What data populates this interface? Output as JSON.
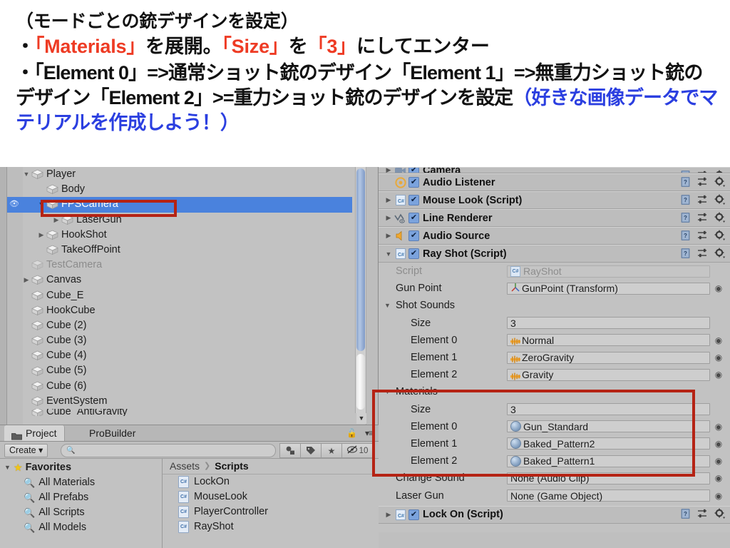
{
  "instructions": {
    "line1": "（モードごとの銃デザインを設定）",
    "line2_bullet": "・",
    "line2_a": "「Materials」",
    "line2_b": "を展開。",
    "line2_c": "「Size」",
    "line2_d": "を",
    "line2_e": "「3」",
    "line2_f": "にしてエンター",
    "line3_bullet": "・",
    "line3_a": "「Element 0」=>通常ショット銃のデザイン「Element 1」=>無重力ショット銃のデザイン「Element 2」>=重力ショット銃のデザインを設定",
    "line3_b": "（好きな画像データでマテリアルを作成しよう！）",
    "colors": {
      "red": "#ee3b24",
      "blue": "#2b3fe0",
      "black": "#111111"
    }
  },
  "hierarchy": {
    "items": [
      {
        "label": "Player",
        "depth": 1,
        "tri": "down",
        "dim": false,
        "selected": false,
        "eye": false
      },
      {
        "label": "Body",
        "depth": 2,
        "tri": "none",
        "dim": false,
        "selected": false,
        "eye": false
      },
      {
        "label": "FPSCamera",
        "depth": 2,
        "tri": "down",
        "dim": false,
        "selected": true,
        "eye": true
      },
      {
        "label": "LaserGun",
        "depth": 3,
        "tri": "right",
        "dim": false,
        "selected": false,
        "eye": false
      },
      {
        "label": "HookShot",
        "depth": 2,
        "tri": "right",
        "dim": false,
        "selected": false,
        "eye": false
      },
      {
        "label": "TakeOffPoint",
        "depth": 2,
        "tri": "none",
        "dim": false,
        "selected": false,
        "eye": false
      },
      {
        "label": "TestCamera",
        "depth": 1,
        "tri": "none",
        "dim": true,
        "selected": false,
        "eye": false
      },
      {
        "label": "Canvas",
        "depth": 1,
        "tri": "right",
        "dim": false,
        "selected": false,
        "eye": false
      },
      {
        "label": "Cube_E",
        "depth": 1,
        "tri": "none",
        "dim": false,
        "selected": false,
        "eye": false
      },
      {
        "label": "HookCube",
        "depth": 1,
        "tri": "none",
        "dim": false,
        "selected": false,
        "eye": false
      },
      {
        "label": "Cube (2)",
        "depth": 1,
        "tri": "none",
        "dim": false,
        "selected": false,
        "eye": false
      },
      {
        "label": "Cube (3)",
        "depth": 1,
        "tri": "none",
        "dim": false,
        "selected": false,
        "eye": false
      },
      {
        "label": "Cube (4)",
        "depth": 1,
        "tri": "none",
        "dim": false,
        "selected": false,
        "eye": false
      },
      {
        "label": "Cube (5)",
        "depth": 1,
        "tri": "none",
        "dim": false,
        "selected": false,
        "eye": false
      },
      {
        "label": "Cube (6)",
        "depth": 1,
        "tri": "none",
        "dim": false,
        "selected": false,
        "eye": false
      },
      {
        "label": "EventSystem",
        "depth": 1,
        "tri": "none",
        "dim": false,
        "selected": false,
        "eye": false
      },
      {
        "label": "Cube_AntiGravity",
        "depth": 1,
        "tri": "none",
        "dim": false,
        "selected": false,
        "eye": false
      }
    ]
  },
  "project": {
    "tabs": [
      {
        "label": "Project",
        "active": true
      },
      {
        "label": "ProBuilder",
        "active": false
      }
    ],
    "create_label": "Create",
    "search_placeholder": "",
    "search_value": "",
    "hidden_count": "10",
    "breadcrumb": {
      "root": "Assets",
      "current": "Scripts"
    },
    "favorites": {
      "label": "Favorites",
      "items": [
        "All Materials",
        "All Prefabs",
        "All Scripts",
        "All Models"
      ]
    },
    "assets": [
      {
        "name": "LockOn",
        "type": "C#"
      },
      {
        "name": "MouseLook",
        "type": "C#"
      },
      {
        "name": "PlayerController",
        "type": "C#"
      },
      {
        "name": "RayShot",
        "type": "C#"
      }
    ]
  },
  "inspector": {
    "components": [
      {
        "name": "Camera",
        "icon": "camera-icon",
        "checked": true,
        "foldout": "right",
        "partial": true
      },
      {
        "name": "Audio Listener",
        "icon": "audio-listener-icon",
        "checked": true,
        "foldout": "none",
        "partial": false
      },
      {
        "name": "Mouse Look (Script)",
        "icon": "csharp-icon",
        "checked": true,
        "foldout": "right",
        "partial": false
      },
      {
        "name": "Line Renderer",
        "icon": "line-renderer-icon",
        "checked": true,
        "foldout": "right",
        "partial": false
      },
      {
        "name": "Audio Source",
        "icon": "audio-source-icon",
        "checked": true,
        "foldout": "right",
        "partial": false
      },
      {
        "name": "Ray Shot (Script)",
        "icon": "csharp-icon",
        "checked": true,
        "foldout": "down",
        "partial": false
      }
    ],
    "ray_shot_properties": [
      {
        "label": "Script",
        "value": "RayShot",
        "icon": "csharp-icon",
        "indent": 1,
        "dim": true,
        "target": false,
        "foldout": "none"
      },
      {
        "label": "Gun Point",
        "value": "GunPoint (Transform)",
        "icon": "transform-icon",
        "indent": 1,
        "dim": false,
        "target": true,
        "foldout": "none"
      },
      {
        "label": "Shot Sounds",
        "value": "",
        "icon": "none",
        "indent": 0,
        "dim": false,
        "target": false,
        "foldout": "down"
      },
      {
        "label": "Size",
        "value": "3",
        "icon": "none",
        "indent": 2,
        "dim": false,
        "target": false,
        "foldout": "none"
      },
      {
        "label": "Element 0",
        "value": "Normal",
        "icon": "audio-clip-icon",
        "indent": 2,
        "dim": false,
        "target": true,
        "foldout": "none"
      },
      {
        "label": "Element 1",
        "value": "ZeroGravity",
        "icon": "audio-clip-icon",
        "indent": 2,
        "dim": false,
        "target": true,
        "foldout": "none"
      },
      {
        "label": "Element 2",
        "value": "Gravity",
        "icon": "audio-clip-icon",
        "indent": 2,
        "dim": false,
        "target": true,
        "foldout": "none"
      },
      {
        "label": "Materials",
        "value": "",
        "icon": "none",
        "indent": 0,
        "dim": false,
        "target": false,
        "foldout": "down"
      },
      {
        "label": "Size",
        "value": "3",
        "icon": "none",
        "indent": 2,
        "dim": false,
        "target": false,
        "foldout": "none"
      },
      {
        "label": "Element 0",
        "value": "Gun_Standard",
        "icon": "material-icon",
        "indent": 2,
        "dim": false,
        "target": true,
        "foldout": "none"
      },
      {
        "label": "Element 1",
        "value": "Baked_Pattern2",
        "icon": "material-icon",
        "indent": 2,
        "dim": false,
        "target": true,
        "foldout": "none"
      },
      {
        "label": "Element 2",
        "value": "Baked_Pattern1",
        "icon": "material-icon",
        "indent": 2,
        "dim": false,
        "target": true,
        "foldout": "none"
      },
      {
        "label": "Change Sound",
        "value": "None (Audio Clip)",
        "icon": "none",
        "indent": 1,
        "dim": false,
        "target": true,
        "foldout": "none"
      },
      {
        "label": "Laser Gun",
        "value": "None (Game Object)",
        "icon": "none",
        "indent": 1,
        "dim": false,
        "target": true,
        "foldout": "none"
      }
    ],
    "last_component": {
      "name": "Lock On (Script)",
      "icon": "csharp-icon",
      "checked": true,
      "foldout": "right"
    }
  },
  "annotations": {
    "fpscamera_box": "FPSCamera highlighted",
    "materials_box": "Materials array highlighted",
    "color": "#b52314"
  }
}
